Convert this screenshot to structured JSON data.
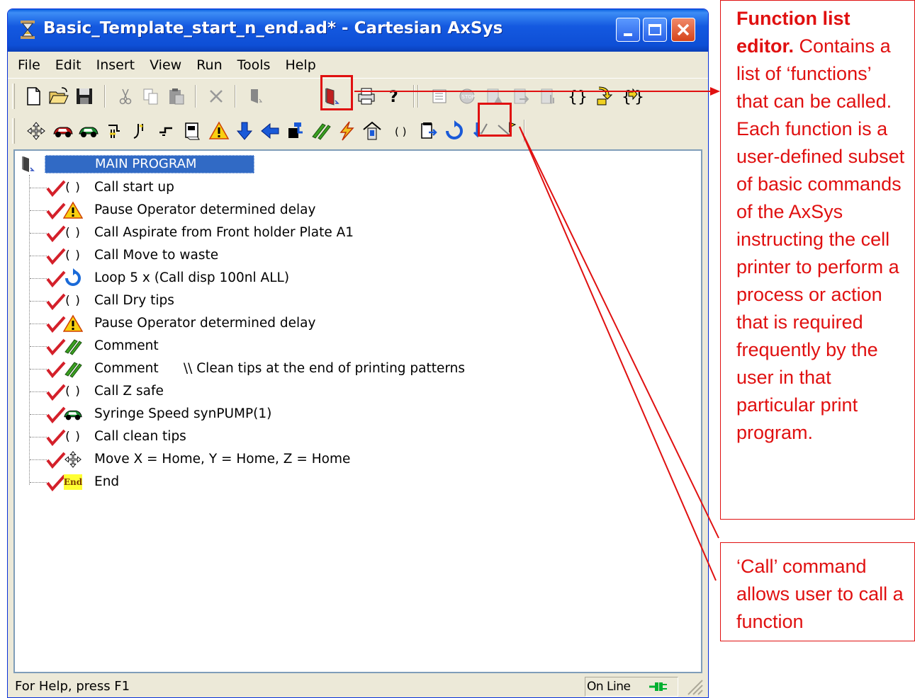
{
  "window": {
    "title": "Basic_Template_start_n_end.ad* - Cartesian AxSys"
  },
  "menu": [
    "File",
    "Edit",
    "Insert",
    "View",
    "Run",
    "Tools",
    "Help"
  ],
  "tree": {
    "root_label": "MAIN PROGRAM",
    "items": [
      {
        "icon": "call-function-icon",
        "text": "Call start up"
      },
      {
        "icon": "warning-pause-icon",
        "text": "Pause Operator determined delay"
      },
      {
        "icon": "call-function-icon",
        "text": "Call Aspirate from Front holder Plate A1"
      },
      {
        "icon": "call-function-icon",
        "text": "Call Move to waste"
      },
      {
        "icon": "loop-icon",
        "text": "Loop 5 x (Call disp 100nl ALL)"
      },
      {
        "icon": "call-function-icon",
        "text": "Call Dry tips"
      },
      {
        "icon": "warning-pause-icon",
        "text": "Pause Operator determined delay"
      },
      {
        "icon": "comment-icon",
        "text": "Comment"
      },
      {
        "icon": "comment-icon",
        "text": "Comment      \\\\ Clean tips at the end of printing patterns"
      },
      {
        "icon": "call-function-icon",
        "text": "Call Z safe"
      },
      {
        "icon": "syringe-car-icon",
        "text": "Syringe Speed synPUMP(1)"
      },
      {
        "icon": "call-function-icon",
        "text": "Call clean tips"
      },
      {
        "icon": "move-arrows-icon",
        "text": "Move X = Home, Y = Home, Z = Home"
      },
      {
        "icon": "end-icon",
        "text": "End"
      }
    ],
    "end_icon_label": "End",
    "call_icon_glyph": "( )"
  },
  "status": {
    "help_text": "For Help, press F1",
    "online_text": "On Line"
  },
  "annotations": {
    "function_list": {
      "title": "Function list editor.",
      "body": " Contains a list of ‘functions’ that can be called. Each function is a user-defined subset of basic commands of the AxSys instructing the cell printer to perform a process or action that is required frequently by the user in that particular print program."
    },
    "call_command": {
      "body": "‘Call’ command allows user to call a function"
    }
  },
  "colors": {
    "titlebar": "#0e4fd6",
    "selection": "#316ac5",
    "annotation": "#e01010",
    "check": "#d4202a",
    "window_bg": "#ece9d8"
  }
}
